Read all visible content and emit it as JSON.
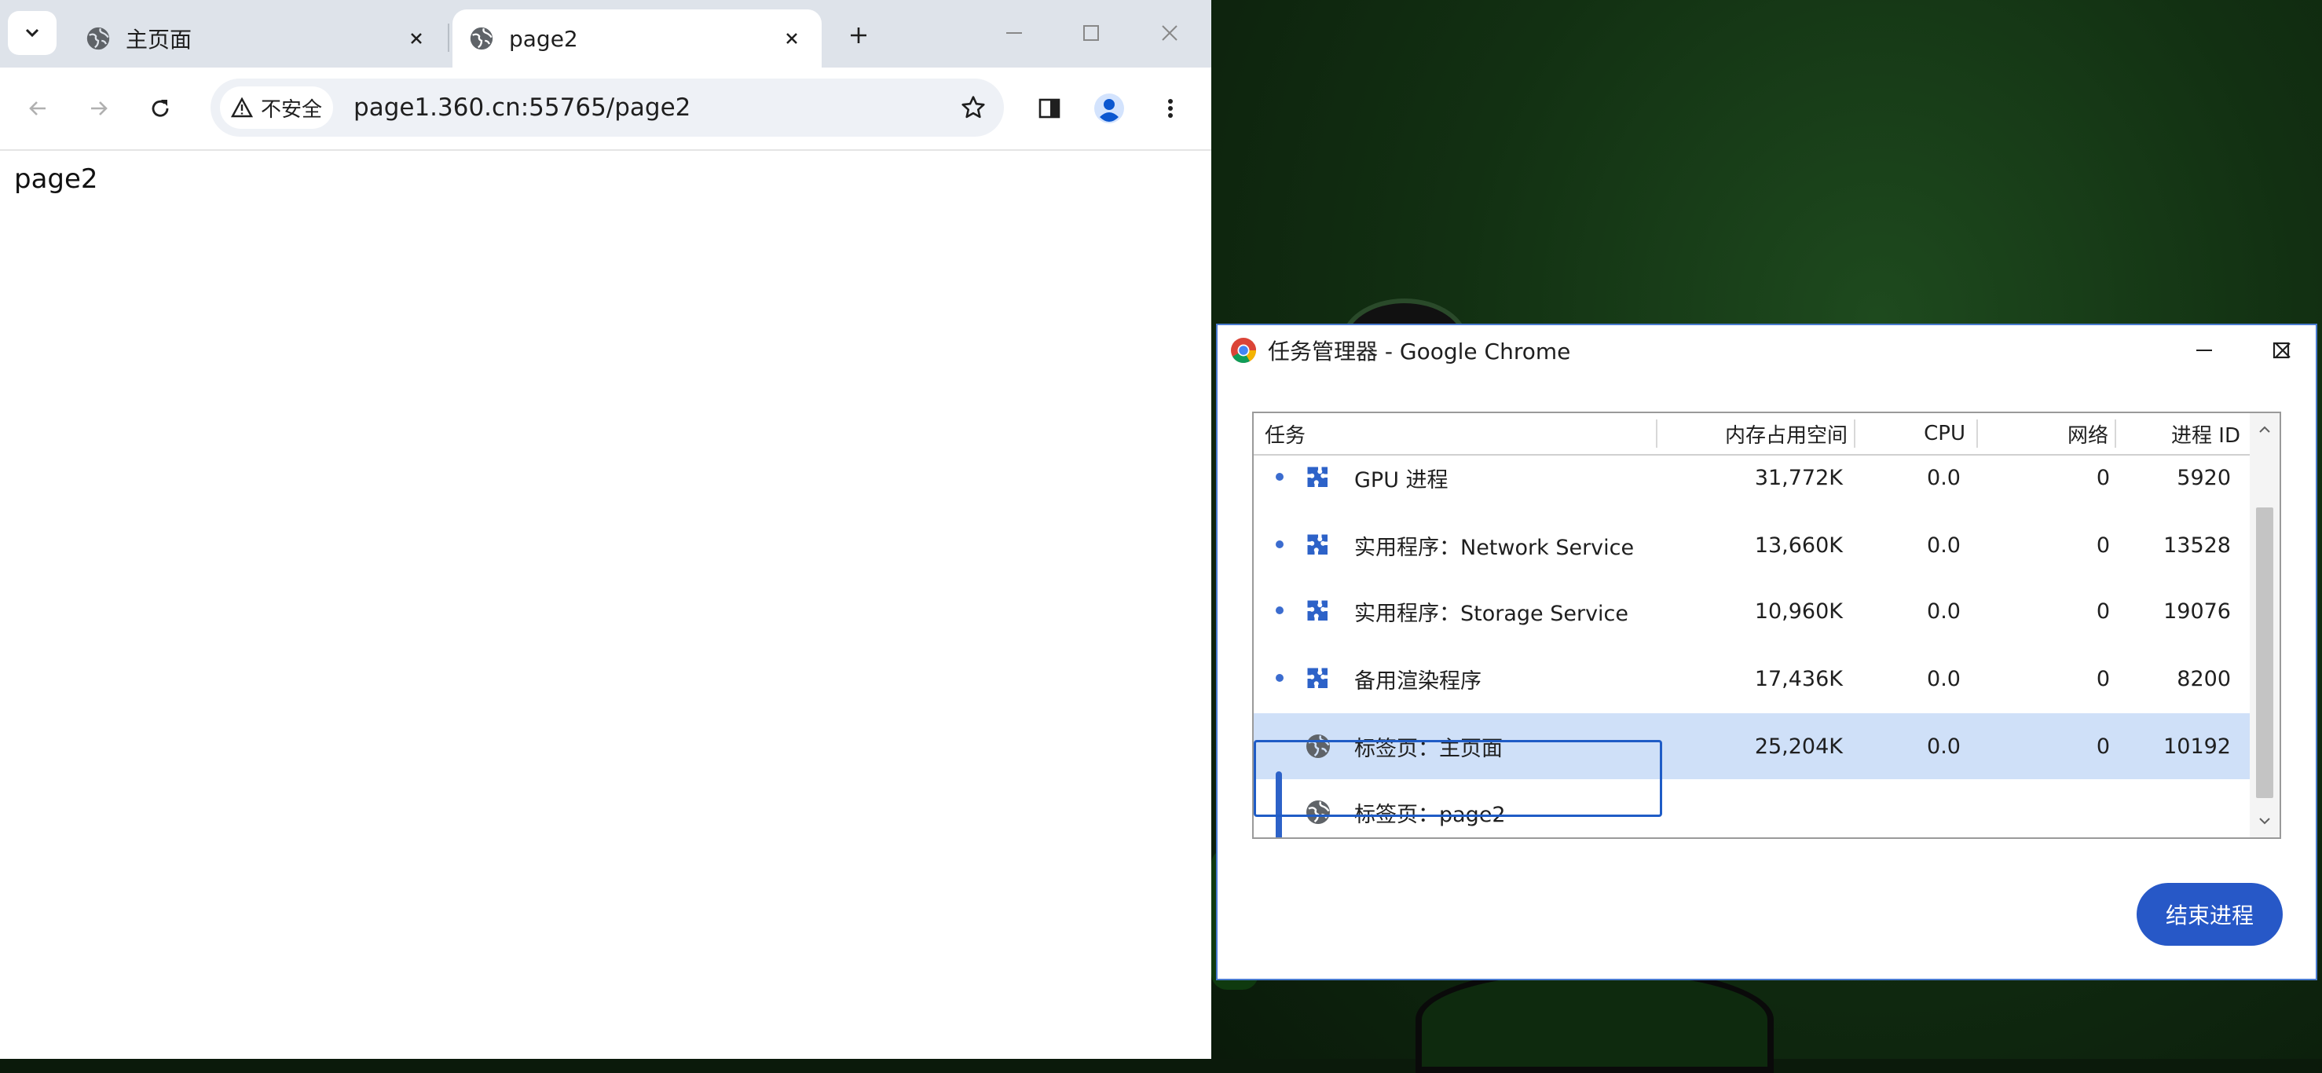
{
  "browser": {
    "tabs": [
      {
        "label": "主页面",
        "active": false
      },
      {
        "label": "page2",
        "active": true
      }
    ],
    "toolbar": {
      "security_label": "不安全",
      "url": "page1.360.cn:55765/page2"
    },
    "page": {
      "body_text": "page2"
    }
  },
  "task_manager": {
    "title": "任务管理器 - Google Chrome",
    "columns": {
      "task": "任务",
      "memory": "内存占用空间",
      "cpu": "CPU",
      "network": "网络",
      "pid": "进程 ID"
    },
    "rows": [
      {
        "icon": "puzzle-icon",
        "name": "GPU 进程",
        "memory": "31,772K",
        "cpu": "0.0",
        "network": "0",
        "pid": "5920"
      },
      {
        "icon": "puzzle-icon",
        "name": "实用程序：Network Service",
        "memory": "13,660K",
        "cpu": "0.0",
        "network": "0",
        "pid": "13528"
      },
      {
        "icon": "puzzle-icon",
        "name": "实用程序：Storage Service",
        "memory": "10,960K",
        "cpu": "0.0",
        "network": "0",
        "pid": "19076"
      },
      {
        "icon": "puzzle-icon",
        "name": "备用渲染程序",
        "memory": "17,436K",
        "cpu": "0.0",
        "network": "0",
        "pid": "8200"
      },
      {
        "icon": "globe-icon",
        "name": "标签页：主页面",
        "memory": "25,204K",
        "cpu": "0.0",
        "network": "0",
        "pid": "10192",
        "selected": true
      },
      {
        "icon": "globe-icon",
        "name": "标签页：page2",
        "memory": "",
        "cpu": "",
        "network": "",
        "pid": ""
      }
    ],
    "end_process_label": "结束进程"
  },
  "colors": {
    "accent": "#2758c7",
    "selected_row": "#cfe0f8",
    "tabstrip": "#dee3ea"
  }
}
